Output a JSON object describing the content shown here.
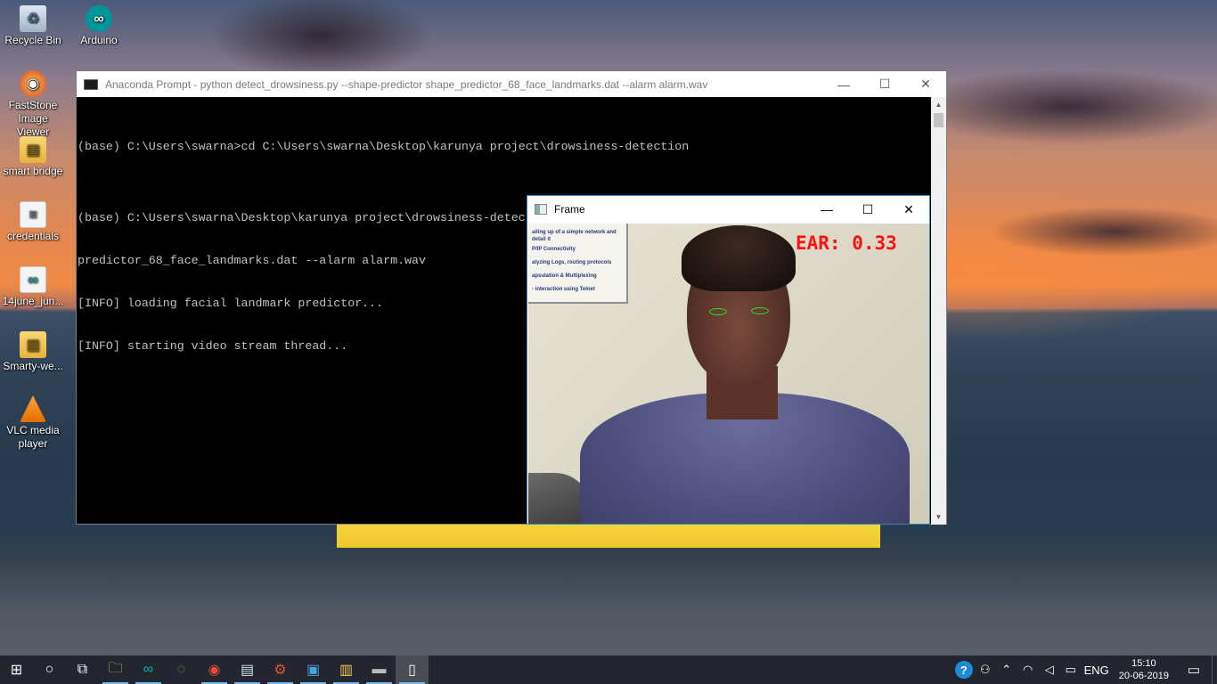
{
  "desktop": {
    "icons": [
      {
        "label": "Recycle Bin",
        "icon": "recycle-bin-icon"
      },
      {
        "label": "Arduino",
        "icon": "arduino-icon"
      },
      {
        "label": "FastStone Image Viewer",
        "icon": "faststone-icon"
      },
      {
        "label": "smart bridge",
        "icon": "file-icon"
      },
      {
        "label": "credentials",
        "icon": "file-icon"
      },
      {
        "label": "14june_jun...",
        "icon": "arduino-file-icon"
      },
      {
        "label": "Smarty-we...",
        "icon": "folder-file-icon"
      },
      {
        "label": "VLC media player",
        "icon": "vlc-icon"
      }
    ]
  },
  "console": {
    "title": "Anaconda Prompt - python  detect_drowsiness.py --shape-predictor shape_predictor_68_face_landmarks.dat --alarm alarm.wav",
    "lines": [
      "(base) C:\\Users\\swarna>cd C:\\Users\\swarna\\Desktop\\karunya project\\drowsiness-detection",
      "",
      "(base) C:\\Users\\swarna\\Desktop\\karunya project\\drowsiness-detection>python detect_drowsiness.py --shape-predictor shape_",
      "predictor_68_face_landmarks.dat --alarm alarm.wav",
      "[INFO] loading facial landmark predictor...",
      "[INFO] starting video stream thread..."
    ]
  },
  "frame_window": {
    "title": "Frame",
    "ear_text": "EAR: 0.33",
    "poster_lines": [
      "ailing up of a simple network and",
      "detail it",
      "P/IP Connectivity",
      "alyzing Logs, routing protocols",
      "apsulation & Multiplexing",
      "- interaction using Telnet"
    ]
  },
  "window_controls": {
    "minimize": "—",
    "maximize": "☐",
    "close": "✕"
  },
  "taskbar": {
    "apps": [
      {
        "name": "start-button",
        "glyph": "⊞",
        "state": ""
      },
      {
        "name": "cortana-button",
        "glyph": "○",
        "state": ""
      },
      {
        "name": "task-view-button",
        "glyph": "⧉",
        "state": ""
      },
      {
        "name": "file-explorer-button",
        "glyph": "🗀",
        "state": "active"
      },
      {
        "name": "arduino-taskbar-button",
        "glyph": "∞",
        "state": "active"
      },
      {
        "name": "loading-app-button",
        "glyph": "◌",
        "state": ""
      },
      {
        "name": "chrome-button",
        "glyph": "◉",
        "state": "active"
      },
      {
        "name": "notepad-button",
        "glyph": "▤",
        "state": "active"
      },
      {
        "name": "settings-gear-button",
        "glyph": "⚙",
        "state": "active"
      },
      {
        "name": "id-app-button",
        "glyph": "▣",
        "state": "active"
      },
      {
        "name": "file-app-button",
        "glyph": "▥",
        "state": "active"
      },
      {
        "name": "terminal-button",
        "glyph": "▬",
        "state": "active"
      },
      {
        "name": "frame-app-button",
        "glyph": "▯",
        "state": "focused"
      }
    ],
    "language": "ENG",
    "time": "15:10",
    "date": "20-06-2019"
  }
}
